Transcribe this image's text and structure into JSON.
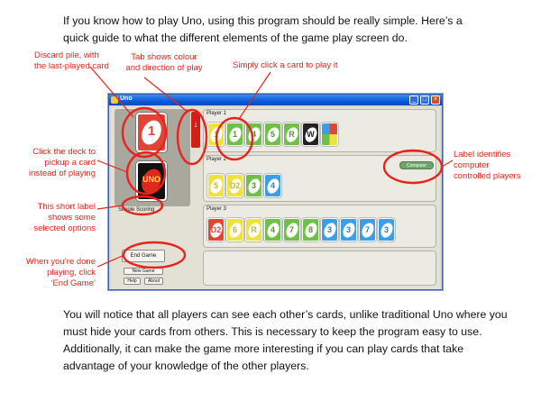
{
  "intro_text": "If you know how to play Uno, using this program should be really simple. Here’s a quick guide to what the different elements of the game play screen do.",
  "outro_text": "You will notice that all players can see each other’s cards, unlike traditional Uno where you must hide your cards from others. This is necessary to keep the program easy to use. Additionally, it can make the game more interesting if you can play cards that take advantage of your knowledge of the other players.",
  "annotations": {
    "discard": "Discard pile, with\nthe last-played card",
    "tab": "Tab shows colour\nand direction of play",
    "click_card": "Simply click a card to play it",
    "deck": "Click the deck to\npickup a card\ninstead of playing",
    "label": "Label identifies\ncomputer\ncontrolled players",
    "short_label": "This short label\nshows some\nselected options",
    "end_game": "When you’re done\nplaying, click\n‘End Game’"
  },
  "window": {
    "title": "Uno",
    "discard_value": "1",
    "deck_text": "UNO",
    "scoring_label": "Simple Scoring",
    "end_game_label": "End Game",
    "new_game_label": "New Game",
    "help_label": "Help",
    "about_label": "About",
    "computer_badge": "Computer",
    "players": [
      {
        "name": "Player 1",
        "cards": [
          {
            "color": "yellow",
            "value": "1"
          },
          {
            "color": "green",
            "value": "1"
          },
          {
            "color": "green",
            "value": "4"
          },
          {
            "color": "green",
            "value": "5"
          },
          {
            "color": "green",
            "value": "R"
          },
          {
            "color": "black",
            "value": "W"
          },
          {
            "color": "wild",
            "value": ""
          }
        ]
      },
      {
        "name": "Player 2",
        "cards": [
          {
            "color": "yellow",
            "value": "5"
          },
          {
            "color": "yellow",
            "value": "D2"
          },
          {
            "color": "green",
            "value": "3"
          },
          {
            "color": "blue",
            "value": "4"
          }
        ]
      },
      {
        "name": "Player 3",
        "cards": [
          {
            "color": "red",
            "value": "D2"
          },
          {
            "color": "yellow",
            "value": "6"
          },
          {
            "color": "yellow",
            "value": "R"
          },
          {
            "color": "green",
            "value": "4"
          },
          {
            "color": "green",
            "value": "7"
          },
          {
            "color": "green",
            "value": "8"
          },
          {
            "color": "blue",
            "value": "3"
          },
          {
            "color": "blue",
            "value": "3"
          },
          {
            "color": "blue",
            "value": "7"
          },
          {
            "color": "blue",
            "value": "3"
          }
        ]
      }
    ]
  },
  "colors": {
    "annotation": "#e8231b",
    "tab": "#d11e16",
    "title_bar": "#0a5ad6"
  }
}
